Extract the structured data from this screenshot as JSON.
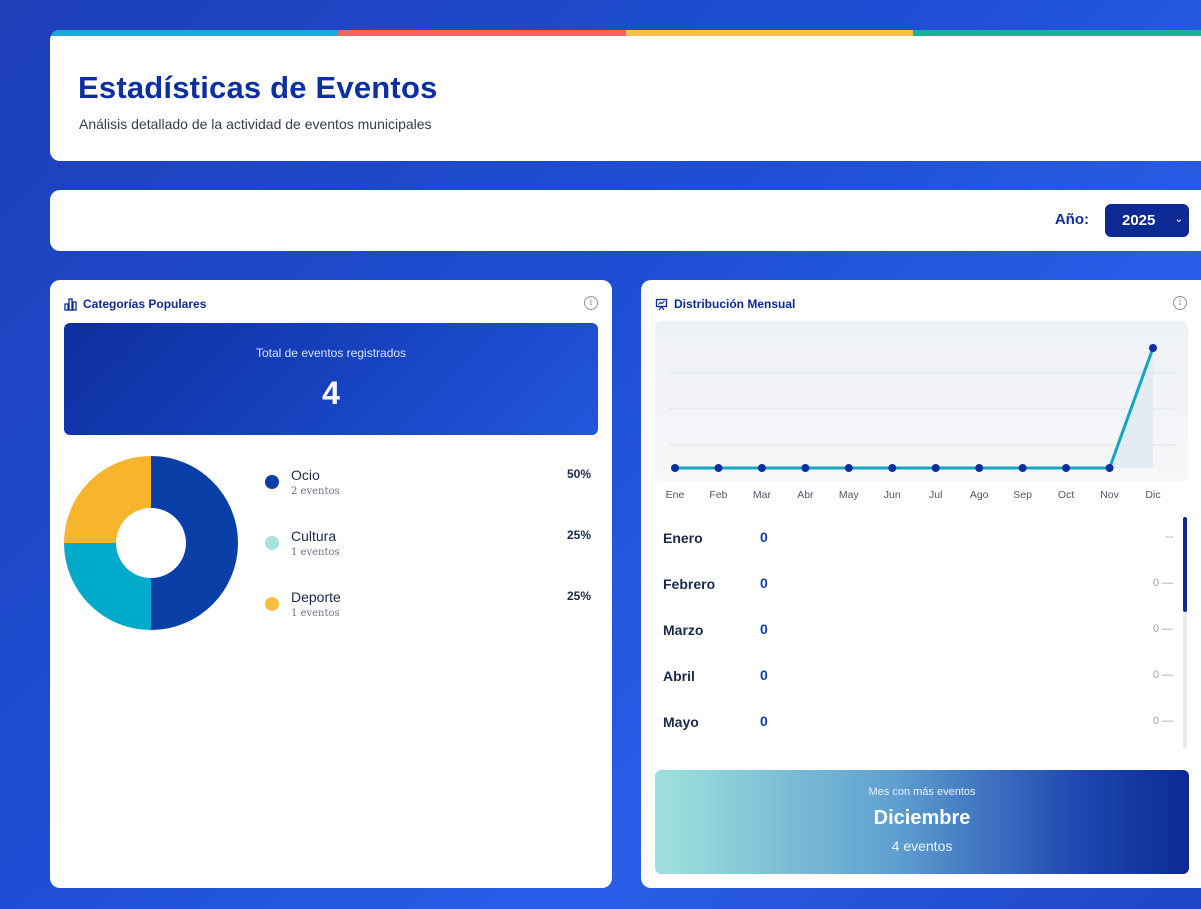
{
  "header": {
    "title": "Estadísticas de Eventos",
    "subtitle": "Análisis detallado de la actividad de eventos municipales",
    "stripe_colors": [
      "#1aa7d9",
      "#ef6461",
      "#f2c14e",
      "#14b39a"
    ]
  },
  "filter": {
    "year_label": "Año:",
    "year_value": "2025"
  },
  "categories": {
    "title": "Categorías Populares",
    "total_label": "Total de eventos registrados",
    "total_value": "4",
    "items": [
      {
        "name": "Ocio",
        "count_label": "2 eventos",
        "percent": "50%",
        "value": 2,
        "color": "#0a3fa8"
      },
      {
        "name": "Cultura",
        "count_label": "1 eventos",
        "percent": "25%",
        "value": 1,
        "color": "#00aac9"
      },
      {
        "name": "Deporte",
        "count_label": "1 eventos",
        "percent": "25%",
        "value": 1,
        "color": "#f7b52c"
      }
    ],
    "legend_dot_colors": [
      "#0a3fa8",
      "#a4e3e0",
      "#f7c140"
    ]
  },
  "monthly": {
    "title": "Distribución Mensual",
    "rows": [
      {
        "name": "Enero",
        "value": "0",
        "trend": "--"
      },
      {
        "name": "Febrero",
        "value": "0",
        "trend": "0 —"
      },
      {
        "name": "Marzo",
        "value": "0",
        "trend": "0 —"
      },
      {
        "name": "Abril",
        "value": "0",
        "trend": "0 —"
      },
      {
        "name": "Mayo",
        "value": "0",
        "trend": "0 —"
      }
    ],
    "top_month_label": "Mes con más eventos",
    "top_month_name": "Diciembre",
    "top_month_count": "4 eventos"
  },
  "chart_data": {
    "type": "line",
    "categories": [
      "Ene",
      "Feb",
      "Mar",
      "Abr",
      "May",
      "Jun",
      "Jul",
      "Ago",
      "Sep",
      "Oct",
      "Nov",
      "Dic"
    ],
    "values": [
      0,
      0,
      0,
      0,
      0,
      0,
      0,
      0,
      0,
      0,
      0,
      4
    ],
    "ylim": [
      0,
      4
    ],
    "grid": true,
    "line_color": "#12a6c2",
    "point_color": "#0a2f9e"
  }
}
